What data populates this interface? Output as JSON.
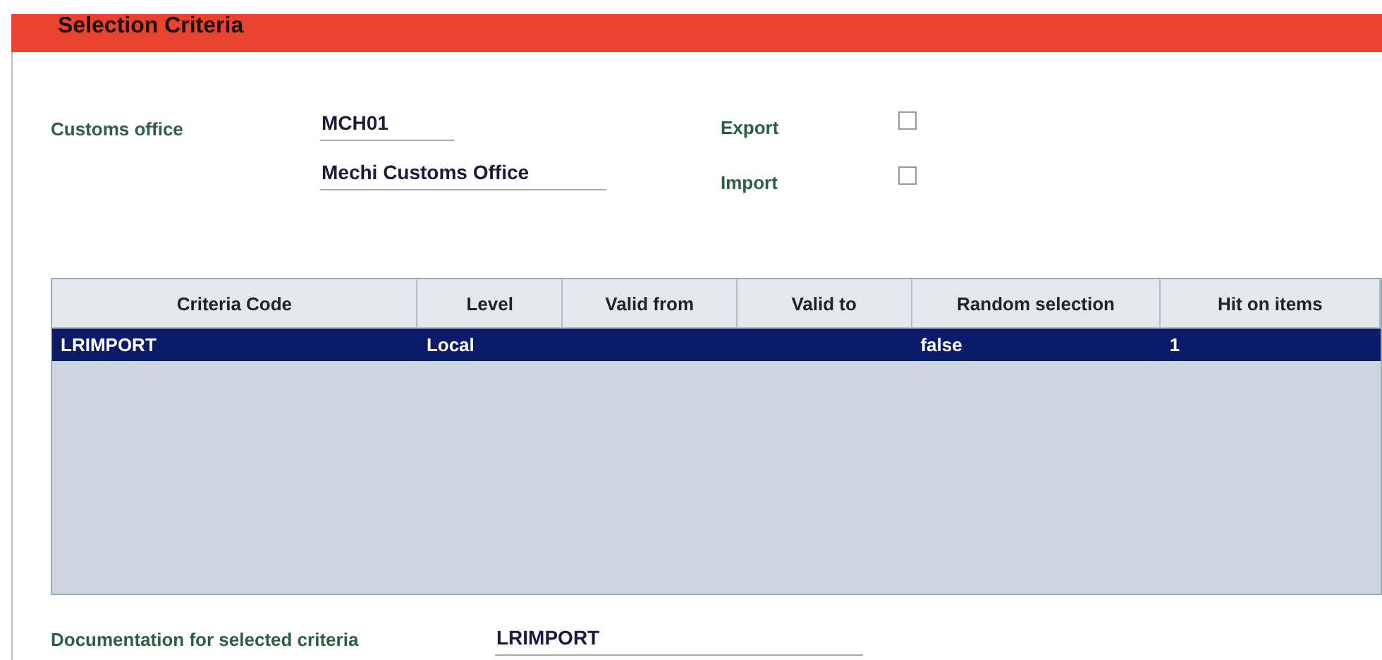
{
  "header": {
    "title": "Selection Criteria"
  },
  "customs_office": {
    "label": "Customs office",
    "code": "MCH01",
    "name": "Mechi Customs Office"
  },
  "options": [
    {
      "label": "Export",
      "checked": false
    },
    {
      "label": "Import",
      "checked": false
    }
  ],
  "table": {
    "columns": [
      "Criteria Code",
      "Level",
      "Valid from",
      "Valid to",
      "Random selection",
      "Hit on items"
    ],
    "rows": [
      {
        "cells": [
          "LRIMPORT",
          "Local",
          "",
          "",
          "false",
          "1"
        ],
        "selected": true
      }
    ]
  },
  "documentation": {
    "label": "Documentation for selected criteria",
    "value": "LRIMPORT"
  }
}
